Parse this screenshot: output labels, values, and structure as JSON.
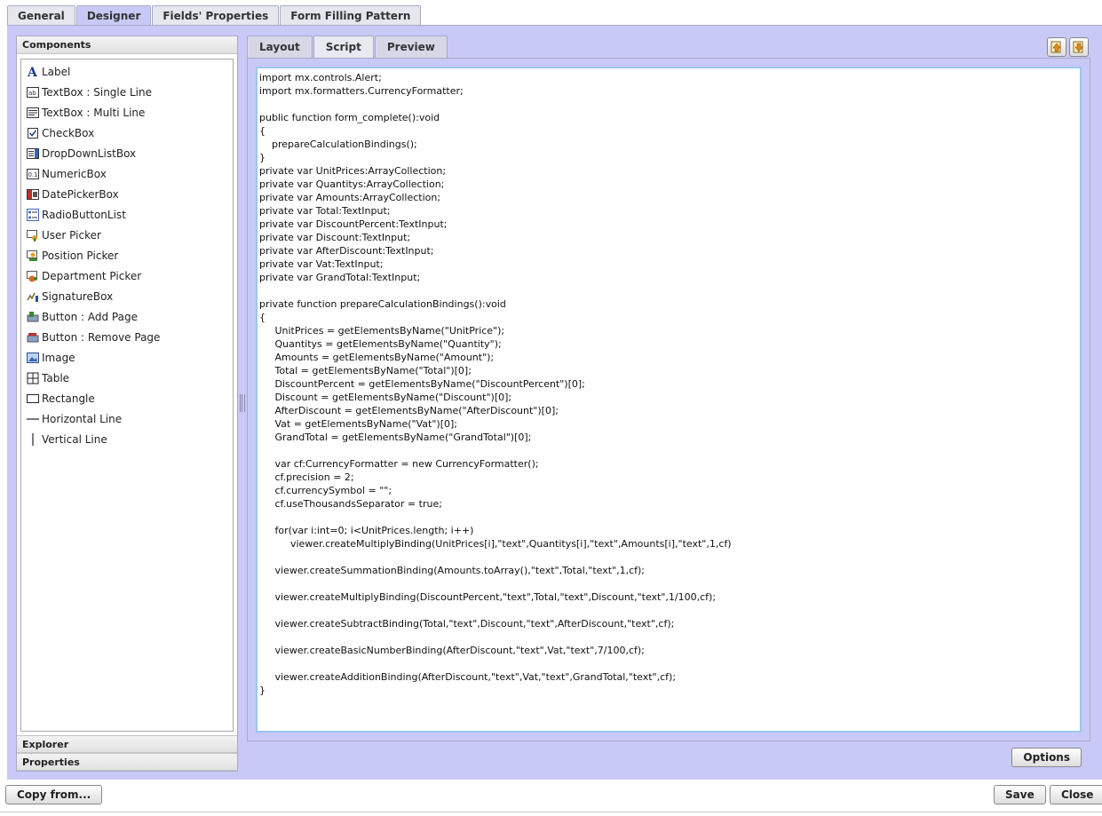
{
  "top_tabs": [
    "General",
    "Designer",
    "Fields' Properties",
    "Form Filling Pattern"
  ],
  "active_top_tab": "Designer",
  "left_panel": {
    "components_title": "Components",
    "components": [
      {
        "label": "Label",
        "icon": "label-a-icon"
      },
      {
        "label": "TextBox : Single Line",
        "icon": "textbox-single-icon"
      },
      {
        "label": "TextBox : Multi Line",
        "icon": "textbox-multi-icon"
      },
      {
        "label": "CheckBox",
        "icon": "checkbox-icon"
      },
      {
        "label": "DropDownListBox",
        "icon": "dropdown-icon"
      },
      {
        "label": "NumericBox",
        "icon": "numeric-icon"
      },
      {
        "label": "DatePickerBox",
        "icon": "datepicker-icon"
      },
      {
        "label": "RadioButtonList",
        "icon": "radio-list-icon"
      },
      {
        "label": "User Picker",
        "icon": "user-picker-icon"
      },
      {
        "label": "Position Picker",
        "icon": "position-picker-icon"
      },
      {
        "label": "Department Picker",
        "icon": "department-picker-icon"
      },
      {
        "label": "SignatureBox",
        "icon": "signature-icon"
      },
      {
        "label": "Button : Add Page",
        "icon": "add-page-icon"
      },
      {
        "label": "Button : Remove Page",
        "icon": "remove-page-icon"
      },
      {
        "label": "Image",
        "icon": "image-icon"
      },
      {
        "label": "Table",
        "icon": "table-icon"
      },
      {
        "label": "Rectangle",
        "icon": "rectangle-icon"
      },
      {
        "label": "Horizontal Line",
        "icon": "horizontal-line-icon"
      },
      {
        "label": "Vertical Line",
        "icon": "vertical-line-icon"
      }
    ],
    "explorer_title": "Explorer",
    "properties_title": "Properties"
  },
  "sub_tabs": [
    "Layout",
    "Script",
    "Preview"
  ],
  "active_sub_tab": "Script",
  "icon_buttons": [
    "import-icon",
    "export-icon"
  ],
  "script_code": "import mx.controls.Alert;\nimport mx.formatters.CurrencyFormatter;\n\npublic function form_complete():void\n{\n    prepareCalculationBindings();\n}\nprivate var UnitPrices:ArrayCollection;\nprivate var Quantitys:ArrayCollection;\nprivate var Amounts:ArrayCollection;\nprivate var Total:TextInput;\nprivate var DiscountPercent:TextInput;\nprivate var Discount:TextInput;\nprivate var AfterDiscount:TextInput;\nprivate var Vat:TextInput;\nprivate var GrandTotal:TextInput;\n\nprivate function prepareCalculationBindings():void\n{\n     UnitPrices = getElementsByName(\"UnitPrice\");\n     Quantitys = getElementsByName(\"Quantity\");\n     Amounts = getElementsByName(\"Amount\");\n     Total = getElementsByName(\"Total\")[0];\n     DiscountPercent = getElementsByName(\"DiscountPercent\")[0];\n     Discount = getElementsByName(\"Discount\")[0];\n     AfterDiscount = getElementsByName(\"AfterDiscount\")[0];\n     Vat = getElementsByName(\"Vat\")[0];\n     GrandTotal = getElementsByName(\"GrandTotal\")[0];\n\n     var cf:CurrencyFormatter = new CurrencyFormatter();\n     cf.precision = 2;\n     cf.currencySymbol = \"\";\n     cf.useThousandsSeparator = true;\n\n     for(var i:int=0; i<UnitPrices.length; i++)\n          viewer.createMultiplyBinding(UnitPrices[i],\"text\",Quantitys[i],\"text\",Amounts[i],\"text\",1,cf)\n\n     viewer.createSummationBinding(Amounts.toArray(),\"text\",Total,\"text\",1,cf);\n\n     viewer.createMultiplyBinding(DiscountPercent,\"text\",Total,\"text\",Discount,\"text\",1/100,cf);\n\n     viewer.createSubtractBinding(Total,\"text\",Discount,\"text\",AfterDiscount,\"text\",cf);\n\n     viewer.createBasicNumberBinding(AfterDiscount,\"text\",Vat,\"text\",7/100,cf);\n\n     viewer.createAdditionBinding(AfterDiscount,\"text\",Vat,\"text\",GrandTotal,\"text\",cf);\n}",
  "buttons": {
    "options": "Options",
    "copy_from": "Copy from...",
    "save": "Save",
    "close": "Close"
  },
  "colors": {
    "panel_bg": "#c9c9f7",
    "editor_border": "#9ec5ef"
  }
}
